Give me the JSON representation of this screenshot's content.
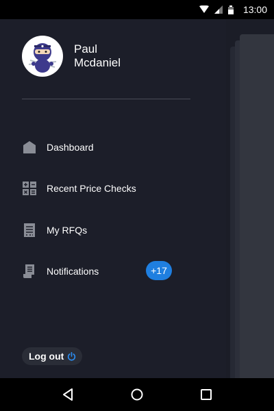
{
  "status_bar": {
    "time": "13:00",
    "icons": [
      "wifi-icon",
      "signal-icon",
      "battery-icon"
    ]
  },
  "user": {
    "first_name": "Paul",
    "last_name": "Mcdaniel",
    "avatar": "ninja-avatar"
  },
  "menu": {
    "items": [
      {
        "label": "Dashboard",
        "icon": "home-icon"
      },
      {
        "label": "Recent Price Checks",
        "icon": "calculator-icon"
      },
      {
        "label": "My RFQs",
        "icon": "document-icon"
      },
      {
        "label": "Notifications",
        "icon": "scroll-icon",
        "badge": "+17"
      }
    ]
  },
  "logout": {
    "label": "Log out",
    "icon": "power-icon"
  },
  "navigation": {
    "buttons": [
      "back-icon",
      "home-circle-icon",
      "recents-icon"
    ]
  },
  "colors": {
    "drawer_bg": "#1c1e29",
    "badge": "#1f7fe0",
    "accent_power": "#2b8cf0",
    "icon_gray": "#8a8d96"
  }
}
